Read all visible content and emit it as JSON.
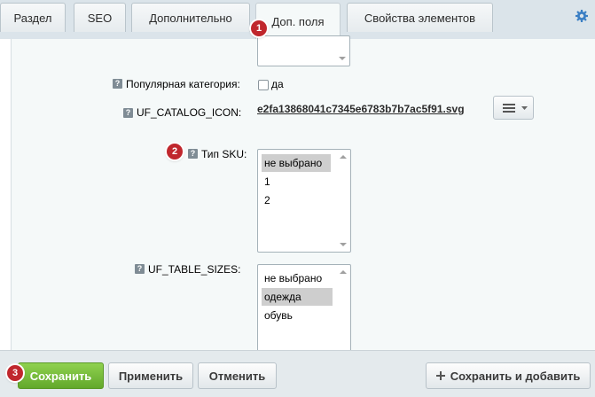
{
  "tabs": [
    {
      "label": "Раздел"
    },
    {
      "label": "SEO"
    },
    {
      "label": "Дополнительно"
    },
    {
      "label": "Доп. поля"
    },
    {
      "label": "Свойства элементов"
    }
  ],
  "fields": {
    "popular_category": {
      "label": "Популярная категория:",
      "checkbox_label": "да",
      "checked": false
    },
    "catalog_icon": {
      "label": "UF_CATALOG_ICON:",
      "file": "e2fa13868041c7345e6783b7b7ac5f91.svg"
    },
    "sku_type": {
      "label": "Тип SKU:",
      "options": [
        "не выбрано",
        "1",
        "2"
      ],
      "selected": "не выбрано"
    },
    "table_sizes": {
      "label": "UF_TABLE_SIZES:",
      "options": [
        "не выбрано",
        "одежда",
        "обувь"
      ],
      "selected": "одежда"
    }
  },
  "badges": {
    "b1": "1",
    "b2": "2",
    "b3": "3"
  },
  "help_glyph": "?",
  "footer": {
    "save": "Сохранить",
    "apply": "Применить",
    "cancel": "Отменить",
    "save_and_add": "Сохранить и добавить"
  },
  "colors": {
    "accent_green": "#6db33a",
    "badge_red": "#c0272d"
  },
  "icons": [
    "gear-icon",
    "help-icon",
    "hamburger-menu-icon",
    "chevron-down-icon",
    "plus-icon"
  ]
}
